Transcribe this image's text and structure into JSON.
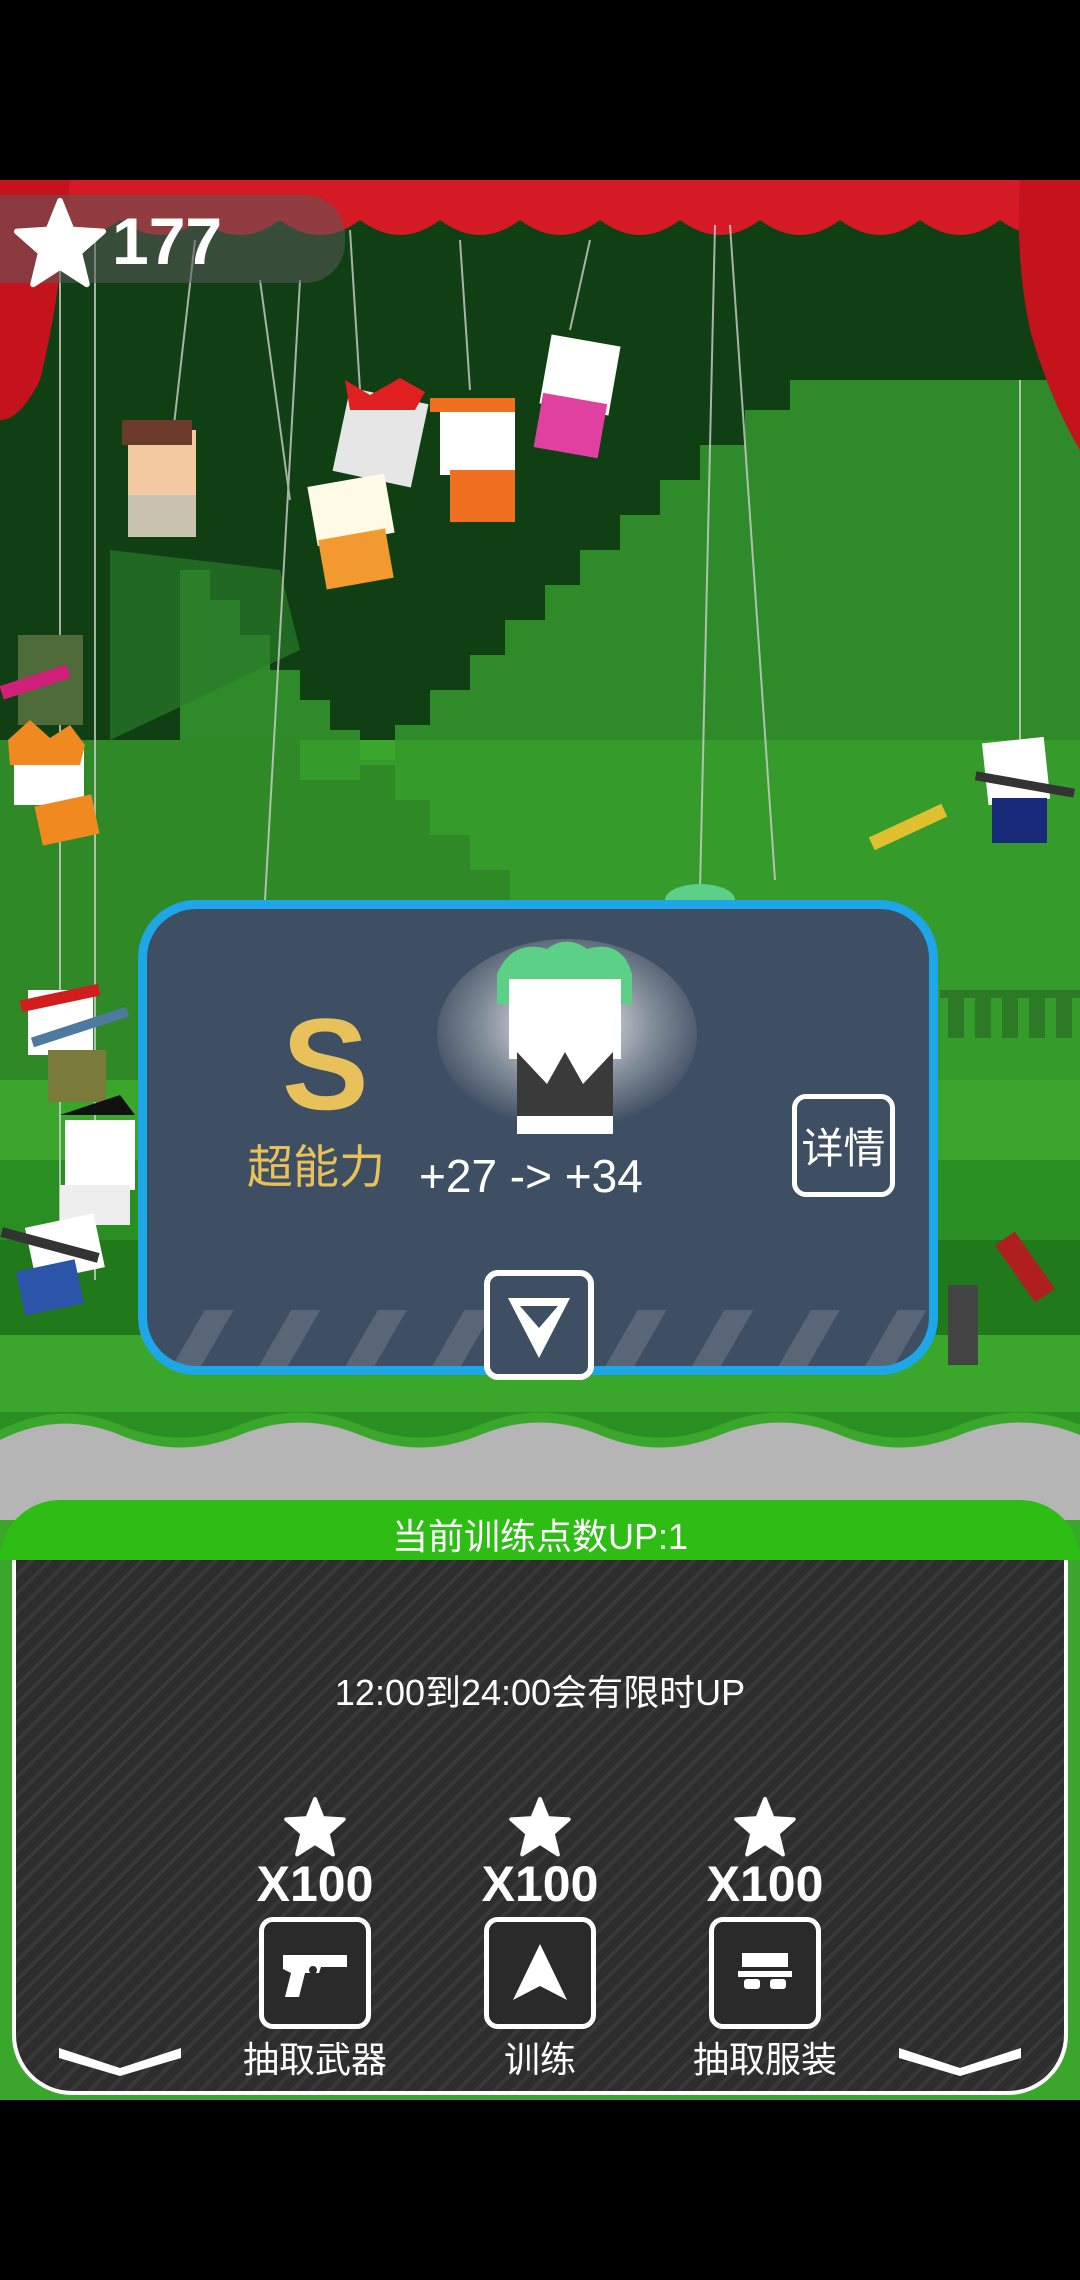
{
  "star_count": "177",
  "result_card": {
    "grade": "S",
    "attribute_name": "超能力",
    "stat_change": "+27 -> +34",
    "details_label": "详情",
    "collapse_icon": "triangle-down-icon"
  },
  "training_banner": "当前训练点数UP:1",
  "limited_notice": "12:00到24:00会有限时UP",
  "actions": [
    {
      "cost": "X100",
      "label": "抽取武器",
      "icon": "revolver-icon"
    },
    {
      "cost": "X100",
      "label": "训练",
      "icon": "arrow-up-icon"
    },
    {
      "cost": "X100",
      "label": "抽取服装",
      "icon": "outfit-icon"
    }
  ],
  "colors": {
    "card_border": "#1ea7e8",
    "card_bg": "#3f4f63",
    "grade_gold": "#e8c15a",
    "banner_green": "#2ebd14",
    "curtain_red": "#d41a24"
  }
}
